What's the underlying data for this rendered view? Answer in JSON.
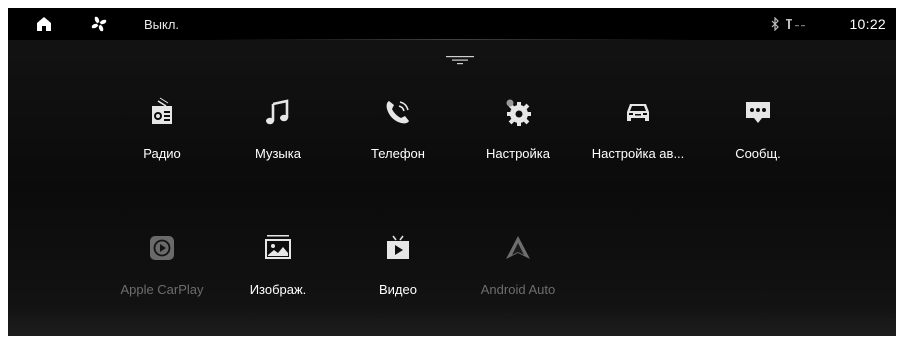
{
  "status_bar": {
    "home_icon": "home-icon",
    "fan_icon": "fan-icon",
    "climate_status": "Выкл.",
    "bluetooth_icon": "bluetooth-icon",
    "signal_icon": "signal-icon",
    "time": "10:22"
  },
  "drawer_handle_icon": "collapse-handle-icon",
  "apps": [
    {
      "label": "Радио",
      "icon": "radio-icon",
      "enabled": true
    },
    {
      "label": "Музыка",
      "icon": "music-icon",
      "enabled": true
    },
    {
      "label": "Телефон",
      "icon": "phone-icon",
      "enabled": true
    },
    {
      "label": "Настройка",
      "icon": "settings-icon",
      "enabled": true
    },
    {
      "label": "Настройка ав...",
      "icon": "car-settings-icon",
      "enabled": true
    },
    {
      "label": "Сообщ.",
      "icon": "messages-icon",
      "enabled": true
    },
    {
      "label": "Apple CarPlay",
      "icon": "carplay-icon",
      "enabled": false
    },
    {
      "label": "Изображ.",
      "icon": "images-icon",
      "enabled": true
    },
    {
      "label": "Видео",
      "icon": "video-icon",
      "enabled": true
    },
    {
      "label": "Android Auto",
      "icon": "android-auto-icon",
      "enabled": false
    }
  ],
  "colors": {
    "background": "#0d0d0d",
    "text": "#ffffff",
    "disabled_text": "#6d6d6d",
    "icon": "#e6e6e6"
  }
}
